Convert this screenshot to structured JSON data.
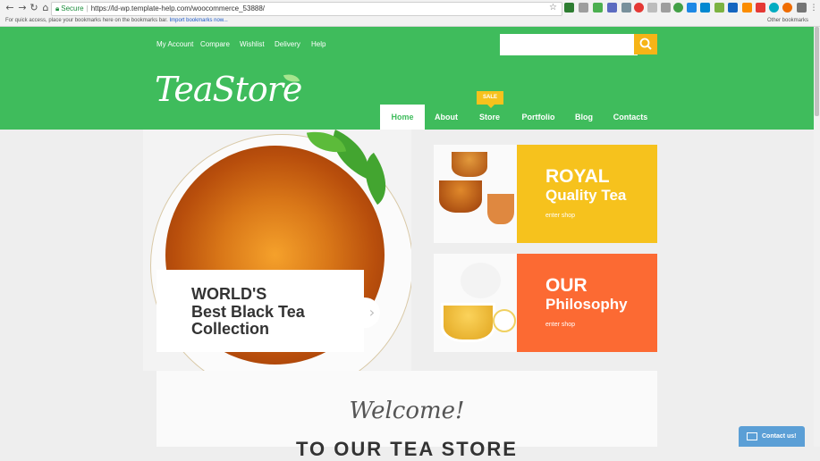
{
  "browser": {
    "security_label": "Secure",
    "url": "https://ld-wp.template-help.com/woocommerce_53888/",
    "bookmarks_message": "For quick access, place your bookmarks here on the bookmarks bar.",
    "bookmarks_link": "Import bookmarks now...",
    "other_bookmarks": "Other bookmarks"
  },
  "topnav": [
    "My Account",
    "Compare",
    "Wishlist",
    "Delivery",
    "Help"
  ],
  "search": {
    "placeholder": ""
  },
  "logo": {
    "text": "TeaStore"
  },
  "mainnav": {
    "items": [
      "Home",
      "About",
      "Store",
      "Portfolio",
      "Blog",
      "Contacts"
    ],
    "active": "Home",
    "sale_badge": "SALE"
  },
  "hero": {
    "line1": "WORLD'S",
    "line2": "Best Black Tea",
    "line3": "Collection"
  },
  "promos": [
    {
      "big": "ROYAL",
      "sub": "Quality Tea",
      "cta": "enter shop",
      "color": "#f6c21d"
    },
    {
      "big": "OUR",
      "sub": "Philosophy",
      "cta": "enter shop",
      "color": "#fc6a33"
    }
  ],
  "welcome": {
    "script": "Welcome!",
    "heading": "TO OUR TEA STORE"
  },
  "contact": {
    "label": "Contact us!"
  },
  "colors": {
    "brand_green": "#3fbc5c",
    "accent_yellow": "#f6b417",
    "contact_blue": "#5b9fd6"
  }
}
